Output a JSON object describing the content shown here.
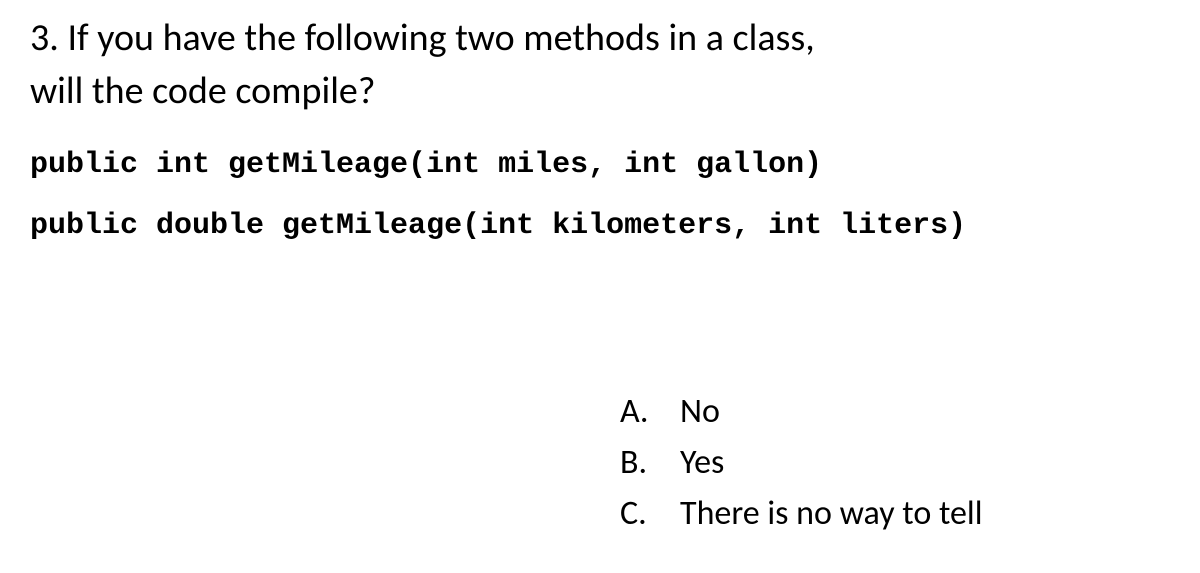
{
  "question": {
    "number": "3.",
    "text_line1": "If you have the following two methods in a class,",
    "text_line2": "will the code compile?"
  },
  "code": {
    "line1": "public int getMileage(int miles, int gallon)",
    "line2": "public double getMileage(int kilometers, int liters)"
  },
  "answers": [
    {
      "letter": "A.",
      "text": "No"
    },
    {
      "letter": "B.",
      "text": "Yes"
    },
    {
      "letter": "C.",
      "text": "There is no way to tell"
    }
  ]
}
